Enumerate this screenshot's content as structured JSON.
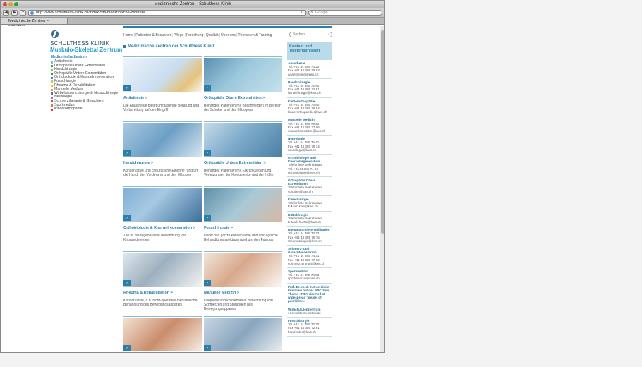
{
  "window": {
    "title": "Medizinische Zentren – Schulthess Klinik",
    "tab_label": "Medizinische Zentren – Schulthes..."
  },
  "toolbar": {
    "url": "http://www.schulthess-klinik.ch/index.cfm/medizinische-zentren/",
    "search_placeholder": "Google",
    "back": "◀",
    "forward": "▶",
    "add": "+",
    "reload": "C"
  },
  "brand": {
    "line1": "SCHULTHESS KLINIK",
    "line2": "Muskulo-Skelettal Zentrum"
  },
  "topnav": [
    "Home",
    "Patienten & Besucher",
    "Pflege",
    "Forschung",
    "Qualität",
    "Über uns",
    "Therapien & Training"
  ],
  "search": {
    "placeholder": "Suchen..."
  },
  "sidebar": {
    "title": "Medizinische Zentren",
    "items": [
      {
        "label": "Anästhesie",
        "color": "#7dbfe0"
      },
      {
        "label": "Orthopädie Obere Extremitäten",
        "color": "#4f9a4f"
      },
      {
        "label": "Handchirurgie",
        "color": "#9bc44a"
      },
      {
        "label": "Orthopädie Untere Extremitäten",
        "color": "#3c8c6a"
      },
      {
        "label": "Orthobiologie & Knorpelregeneration",
        "color": "#4d7fb8"
      },
      {
        "label": "Fusschirurgie",
        "color": "#b6d24b"
      },
      {
        "label": "Rheuma & Rehabilitation",
        "color": "#e2c23a"
      },
      {
        "label": "Manuelle Medizin",
        "color": "#d9a43a"
      },
      {
        "label": "Wirbelsäulenchirurgie & Neurochirurgie",
        "color": "#7a5fa6"
      },
      {
        "label": "Neurologie",
        "color": "#9b79c2"
      },
      {
        "label": "Schmerztherapie & Gutachten",
        "color": "#c94b3a"
      },
      {
        "label": "Sportmedizin",
        "color": "#e07a2a"
      },
      {
        "label": "Kinderorthopädie",
        "color": "#d23c4a"
      }
    ]
  },
  "main": {
    "heading": "Medizinische Zentren der Schulthess Klinik",
    "cards": [
      {
        "title": "Anästhesie >",
        "desc": "Die Anästhesie bietet umfassende Beratung und Vorbereitung auf den Eingriff"
      },
      {
        "title": "Orthopädie Obere Extremitäten >",
        "desc": "Behandelt Patienten mit Beschwerden im Bereich der Schulter und des Ellbogens"
      },
      {
        "title": "Handchirurgie >",
        "desc": "Konservative und chirurgische Eingriffe rund um die Hand, den Vorderarm und den Ellbogen"
      },
      {
        "title": "Orthopädie Untere Extremitäten >",
        "desc": "Behandelt Patienten mit Erkrankungen und Verletzungen der Kniegelenke und der Hüfte"
      },
      {
        "title": "Orthobiologie & Knorpelregeneration >",
        "desc": "Ziel ist die regenerative Behandlung von Knorpeldefekten"
      },
      {
        "title": "Fusschirurgie >",
        "desc": "Deckt das ganze konservative und chirurgische Behandlungsspektrum rund um den Fuss ab"
      },
      {
        "title": "Rheuma & Rehabilitation >",
        "desc": "Konservative, d.h. nicht-operative medizinische Behandlung des Bewegungsapparats"
      },
      {
        "title": "Manuelle Medizin >",
        "desc": "Diagnose und konservative Behandlung von Schmerzen und Störungen des Bewegungsapparats"
      },
      {
        "title": "",
        "desc": ""
      },
      {
        "title": "",
        "desc": ""
      }
    ]
  },
  "contacts": {
    "heading": "Kontakt und Telefonadressen",
    "blocks": [
      {
        "title": "Anästhesie",
        "lines": [
          "Tel. +41 44 385 74 22",
          "Fax +41 44 385 75 93",
          "anaesthesie@kws.ch"
        ]
      },
      {
        "title": "Handchirurgie",
        "lines": [
          "Tel. +41 44 385 72 40",
          "Fax +41 44 385 72 81",
          "handchirurgie@kws.ch"
        ]
      },
      {
        "title": "Kinderorthopädie",
        "lines": [
          "Tel. +41 44 385 74 80",
          "Fax +41 44 385 78 84",
          "kinderorthopaedie@kws.ch"
        ]
      },
      {
        "title": "Manuelle Medizin",
        "lines": [
          "Tel. +41 44 385 73 21",
          "Fax +41 44 385 77 96",
          "manuellemedizin@kws.ch"
        ]
      },
      {
        "title": "Neurologie",
        "lines": [
          "Tel. +41 44 385 75 41",
          "Fax +41 44 385 75 74",
          "neurologie@kws.ch"
        ]
      },
      {
        "title": "Orthobiologie und Knorpelregeneration",
        "lines": [
          "Telefonliste Sekretariate",
          "Tel. +4144 385 74 99",
          "orthobiologie@kws.ch"
        ]
      },
      {
        "title": "Orthopädie Obere Extremitäten",
        "lines": [
          "Telefonliste Sekretariate",
          "schulter@kws.ch"
        ]
      },
      {
        "title": "Kniechirurgie",
        "lines": [
          "Telefonliste Sekretariate",
          "E-Mail: knie@kws.ch"
        ]
      },
      {
        "title": "Hüftchirurgie",
        "lines": [
          "Telefonliste Sekretariate",
          "E-Mail: huefte@kws.ch"
        ]
      },
      {
        "title": "Rheuma und Rehabilitation",
        "lines": [
          "Tel. +41 44 385 74 33",
          "Fax +41 44 385 75 76",
          "rheumatologie@kws.ch"
        ]
      },
      {
        "title": "Schmerz- und Gutachtenzentrum",
        "lines": [
          "Tel. +41 44 385 74 31",
          "Fax +41 44 385 77 92",
          "schmerzzentrum@kws.ch"
        ]
      },
      {
        "title": "Sportmedizin",
        "lines": [
          "Tel. +41 44 385 74 53",
          "sportmedizin@kws.ch"
        ]
      },
      {
        "title": "Prof. Dr. med. J. Dvorák im Interview mit der BBC zum Thema «FIFA alarmed at widespread 'abuse' of painkillers»",
        "lines": []
      },
      {
        "title": "Wirbelsäulenzentrum",
        "lines": [
          ">Kontakte Sekretariate"
        ]
      },
      {
        "title": "Fusschirurgie",
        "lines": [
          "Tel. +41 44 385 72 30",
          "Fax +41 44 385 72 81",
          "fusszenter@kws.ch"
        ]
      }
    ]
  }
}
